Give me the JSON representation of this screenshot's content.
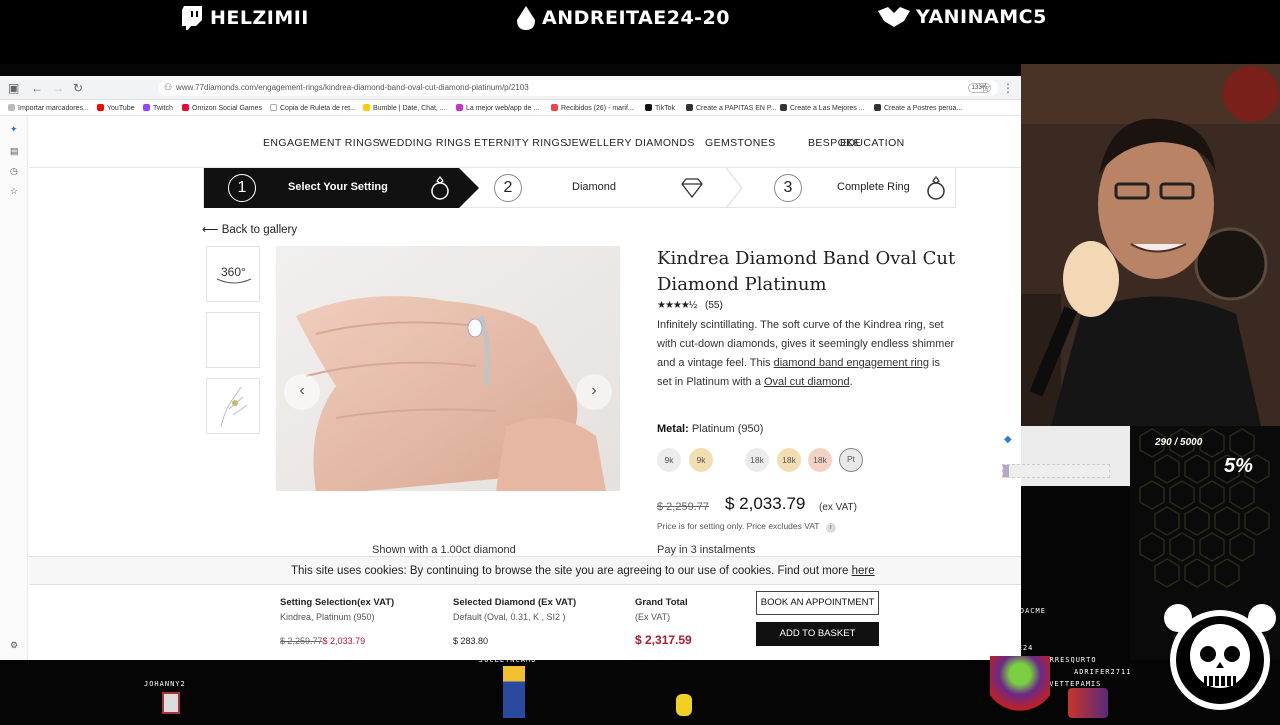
{
  "stream": {
    "streamers": [
      "HELZIMII",
      "ANDREITAE24-20",
      "YANINAMC5"
    ],
    "goal": {
      "text": "290 / 5000",
      "percent": "5%",
      "progress": 0.058
    },
    "viewers": [
      "JOHANNY2",
      "JOCELYNCAMU",
      "LIDDOSOFP",
      "BRUNDACME",
      "ANDREITAE24",
      "PIERRESQURTO",
      "ADRIFER2711",
      "IVETTEPAMIS"
    ],
    "brand": "BRUNDACME"
  },
  "browser": {
    "url": "www.77diamonds.com/engagement-rings/kindrea-diamond-band-oval-cut-diamond-platinum/p/2103",
    "zoom": "133%",
    "bookmarks": [
      "Importar marcadores...",
      "YouTube",
      "Twitch",
      "Onrizon Social Games",
      "Copia de Ruleta de ret...",
      "Bumble | Date, Chat, ...",
      "La mejor web/app de ...",
      "Recibidos (26) - marif...",
      "TikTok",
      "Create a PAPITAS EN P...",
      "Create a Las Mejores ...",
      "Create a Postres perua..."
    ]
  },
  "nav": [
    "ENGAGEMENT RINGS",
    "WEDDING RINGS",
    "ETERNITY RINGS",
    "JEWELLERY",
    "DIAMONDS",
    "GEMSTONES",
    "BESPOKE",
    "EDUCATION"
  ],
  "steps": [
    {
      "num": "1",
      "label": "Select Your Setting"
    },
    {
      "num": "2",
      "label": "Diamond"
    },
    {
      "num": "3",
      "label": "Complete Ring"
    }
  ],
  "gallery": {
    "back": "Back to gallery",
    "thumb_360": "360°",
    "shown_with": "Shown with a 1.00ct diamond"
  },
  "product": {
    "title": "Kindrea Diamond Band Oval Cut Diamond Platinum",
    "reviews": "(55)",
    "rating": 4.5,
    "desc_1": "Infinitely scintillating. The soft curve of the Kindrea ring, set with cut-down diamonds, gives it seemingly endless shimmer and a vintage feel. This ",
    "desc_link1": "diamond band engagement ring",
    "desc_2": " is set in Platinum with a ",
    "desc_link2": "Oval cut diamond",
    "desc_3": ".",
    "metal_label": "Metal:",
    "metal_value": "Platinum (950)",
    "swatches": [
      {
        "label": "9k",
        "color": "#ececec"
      },
      {
        "label": "9k",
        "color": "#f1dfb2"
      },
      {
        "label": "18k",
        "color": "#ececec"
      },
      {
        "label": "18k",
        "color": "#f1dfb2"
      },
      {
        "label": "18k",
        "color": "#f3d4c4"
      },
      {
        "label": "Pt",
        "color": "#e9e9e9"
      }
    ],
    "old_price": "$ 2,259.77",
    "price": "$ 2,033.79",
    "price_vat": "(ex VAT)",
    "price_note": "Price is for setting only. Price excludes VAT",
    "pay": "Pay in 3 instalments"
  },
  "cookie": {
    "text": "This site uses cookies: By continuing to browse the site you are agreeing to our use of cookies. Find out more ",
    "link": "here"
  },
  "basket": {
    "setting_title": "Setting Selection(ex VAT)",
    "setting_sub": "Kindrea, Platinum (950)",
    "setting_old": "$ 2,259.77",
    "setting_new": "$ 2,033.79",
    "diamond_title": "Selected Diamond (Ex VAT)",
    "diamond_sub": "Default (Oval, 0.31, K , SI2 )",
    "diamond_price": "$ 283.80",
    "total_title": "Grand Total",
    "total_sub": "(Ex VAT)",
    "total_price": "$ 2,317.59",
    "book": "BOOK AN APPOINTMENT",
    "add": "ADD TO BASKET"
  }
}
